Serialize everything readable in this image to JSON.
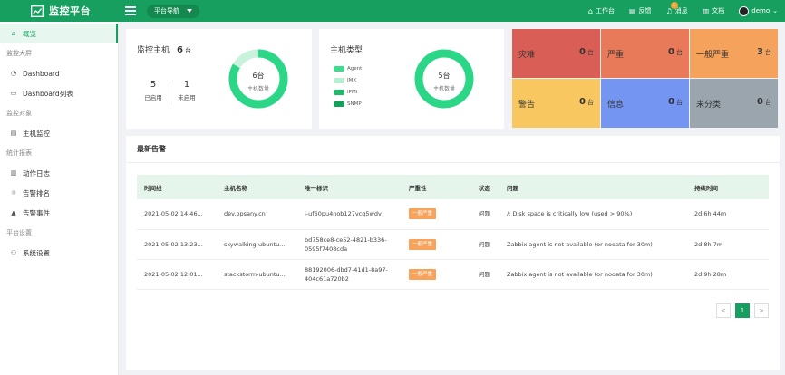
{
  "topbar": {
    "app_title": "监控平台",
    "nav_select": "平台导航",
    "items": [
      {
        "icon": "home-icon",
        "label": "工作台"
      },
      {
        "icon": "feedback-icon",
        "label": "反馈"
      },
      {
        "icon": "bell-icon",
        "label": "消息",
        "badge": "1"
      },
      {
        "icon": "document-icon",
        "label": "文档"
      }
    ],
    "user": "demo"
  },
  "sidebar": {
    "overview": "概览",
    "g1": "监控大屏",
    "dashboard": "Dashboard",
    "dashboard_list": "Dashboard列表",
    "g2": "监控对象",
    "host_monitor": "主机监控",
    "g3": "统计报表",
    "action_log": "动作日志",
    "alert_rank": "告警排名",
    "alert_event": "告警事件",
    "g4": "平台设置",
    "system_settings": "系统设置"
  },
  "hosts_card": {
    "title": "监控主机",
    "count": "6",
    "unit": "台",
    "enabled_value": "5",
    "enabled_label": "已启用",
    "disabled_value": "1",
    "disabled_label": "未启用",
    "donut_value": "6台",
    "donut_label": "主机数量",
    "enabled_fraction": 0.8333
  },
  "types_card": {
    "title": "主机类型",
    "legend": [
      "Agent",
      "JMX",
      "IPMI",
      "SNMP"
    ],
    "legend_colors": [
      "#3fdc8e",
      "#b6f0d2",
      "#1fb96c",
      "#16a05c"
    ],
    "donut_value": "5台",
    "donut_label": "主机数量"
  },
  "severity": [
    {
      "label": "灾难",
      "count": "0",
      "unit": "台",
      "color": "#d95f56"
    },
    {
      "label": "严重",
      "count": "0",
      "unit": "台",
      "color": "#e97a59"
    },
    {
      "label": "一般严重",
      "count": "3",
      "unit": "台",
      "color": "#f5a25c"
    },
    {
      "label": "警告",
      "count": "0",
      "unit": "台",
      "color": "#f8c75f"
    },
    {
      "label": "信息",
      "count": "0",
      "unit": "台",
      "color": "#7495f1"
    },
    {
      "label": "未分类",
      "count": "0",
      "unit": "台",
      "color": "#9aa5ae"
    }
  ],
  "alerts": {
    "title": "最新告警",
    "columns": [
      "时间线",
      "主机名称",
      "唯一标识",
      "严重性",
      "状态",
      "问题",
      "持续时间"
    ],
    "rows": [
      {
        "time": "2021-05-02 14:46...",
        "host": "dev.opsany.cn",
        "uid": "i-uf60pu4nob127vcq5wdv",
        "severity": "一般严重",
        "status": "问题",
        "problem": "/: Disk space is critically low (used > 90%)",
        "duration": "2d 6h 44m"
      },
      {
        "time": "2021-05-02 13:23...",
        "host": "skywalking-ubuntu...",
        "uid": "bd758ce8-ce52-4821-b336-0595f7408cda",
        "severity": "一般严重",
        "status": "问题",
        "problem": "Zabbix agent is not available (or nodata for 30m)",
        "duration": "2d 8h 7m"
      },
      {
        "time": "2021-05-02 12:01...",
        "host": "stackstorm-ubuntu...",
        "uid": "88192006-dbd7-41d1-8a97-404c61a720b2",
        "severity": "一般严重",
        "status": "问题",
        "problem": "Zabbix agent is not available (or nodata for 30m)",
        "duration": "2d 9h 28m"
      }
    ],
    "pager": {
      "prev": "<",
      "current": "1",
      "next": ">"
    }
  }
}
